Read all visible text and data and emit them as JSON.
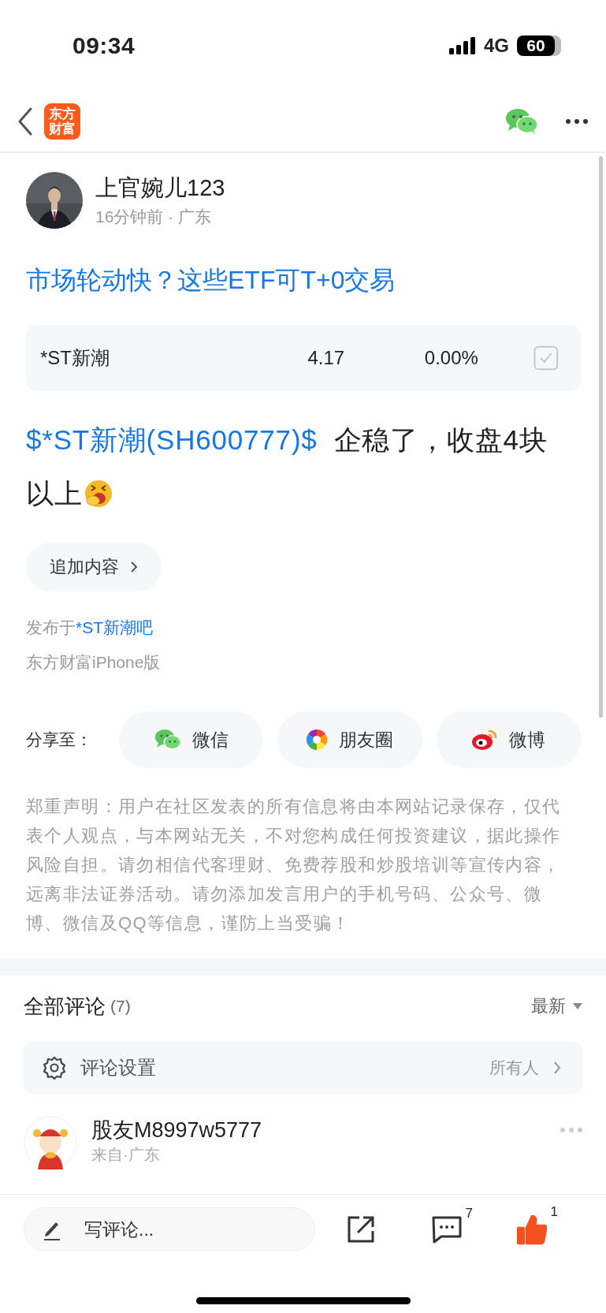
{
  "status_bar": {
    "time": "09:34",
    "network": "4G",
    "battery": "60"
  },
  "nav": {
    "logo_lines": [
      "东方",
      "财富"
    ]
  },
  "post": {
    "author": "上官婉儿123",
    "meta": "16分钟前 · 广东",
    "title": "市场轮动快？这些ETF可T+0交易",
    "stock": {
      "name": "*ST新潮",
      "price": "4.17",
      "change": "0.00%",
      "checked": true
    },
    "body": {
      "link": "$*ST新潮(SH600777)$",
      "text": "企稳了，收盘4块以上"
    },
    "add_content": "追加内容",
    "published": {
      "prefix": "发布于",
      "board": "*ST新潮吧"
    },
    "source": "东方财富iPhone版"
  },
  "share": {
    "label": "分享至：",
    "buttons": [
      {
        "kind": "wechat",
        "label": "微信"
      },
      {
        "kind": "moments",
        "label": "朋友圈"
      },
      {
        "kind": "weibo",
        "label": "微博"
      }
    ]
  },
  "disclaimer": "郑重声明：用户在社区发表的所有信息将由本网站记录保存，仅代表个人观点，与本网站无关，不对您构成任何投资建议，据此操作风险自担。请勿相信代客理财、免费荐股和炒股培训等宣传内容，远离非法证券活动。请勿添加发言用户的手机号码、公众号、微博、微信及QQ等信息，谨防上当受骗！",
  "comments": {
    "title": "全部评论",
    "count": "(7)",
    "sort": "最新",
    "settings": {
      "label": "评论设置",
      "value": "所有人"
    },
    "items": [
      {
        "user": "股友M8997w5777",
        "location": "来自·广东"
      }
    ]
  },
  "bottom_bar": {
    "placeholder": "写评论...",
    "comment_count": "7",
    "like_count": "1",
    "liked": true
  }
}
